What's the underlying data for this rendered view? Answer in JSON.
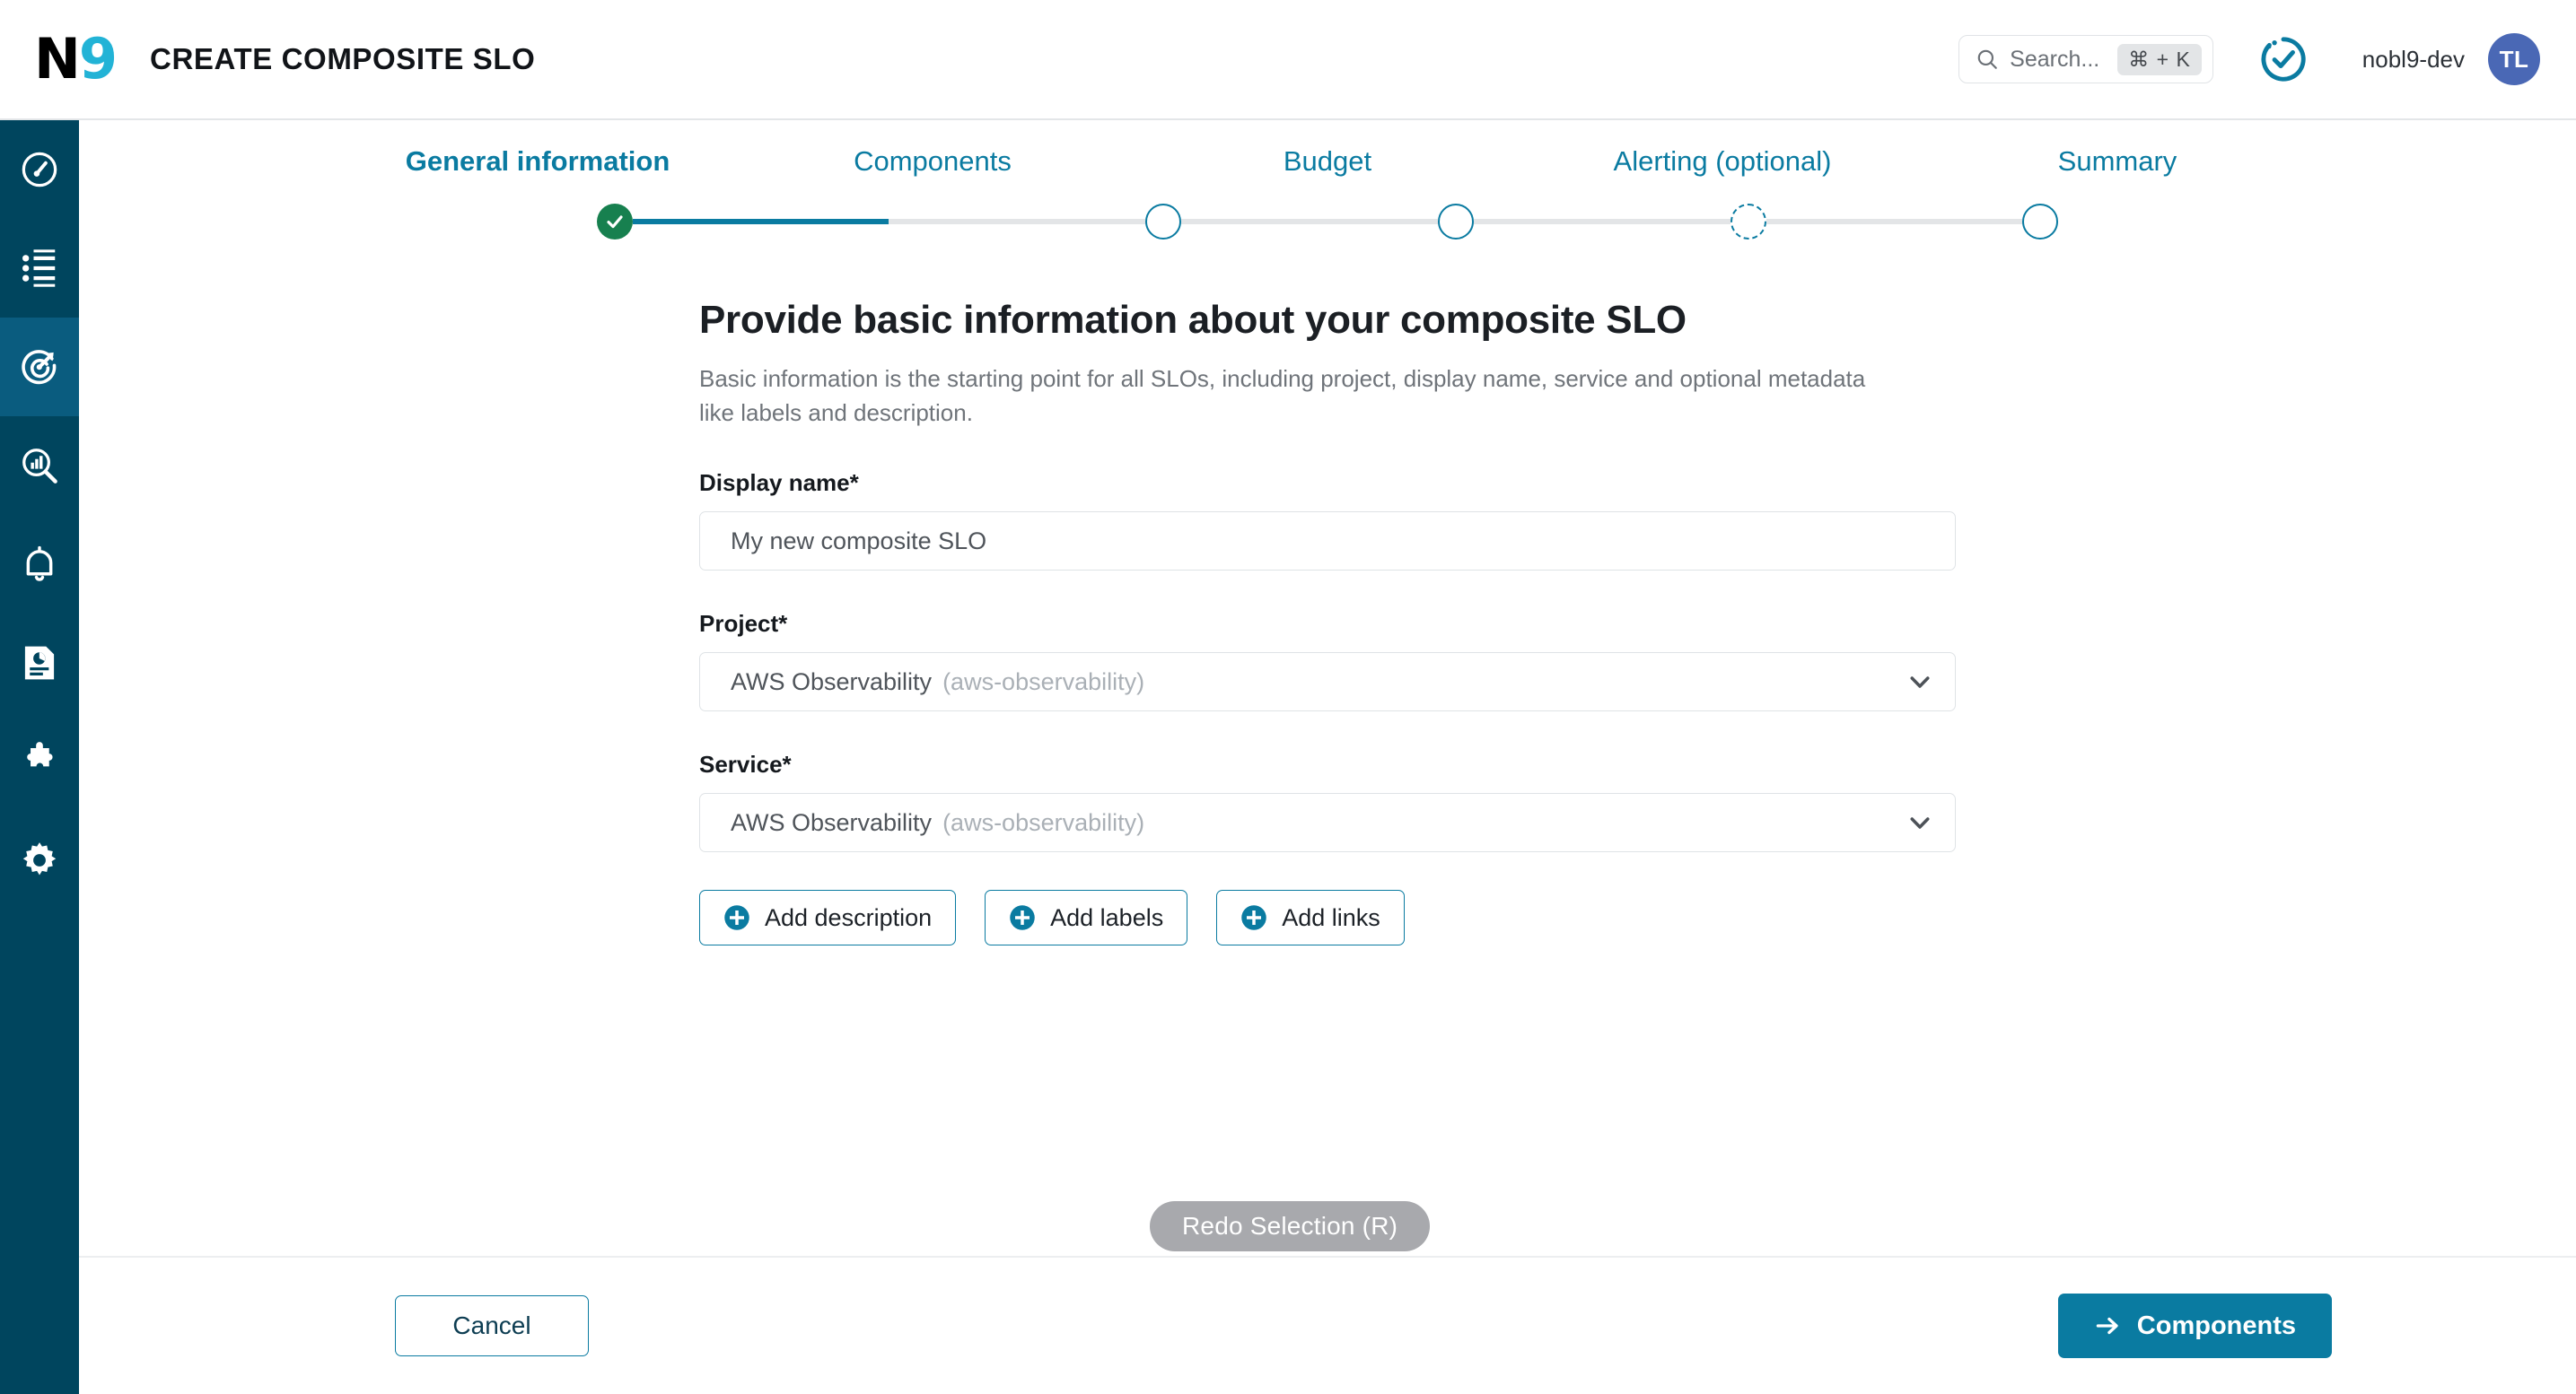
{
  "header": {
    "logo_text_primary": "N",
    "logo_text_accent": "9",
    "title": "CREATE COMPOSITE SLO",
    "search_placeholder": "Search...",
    "search_shortcut": "⌘ + K",
    "org_name": "nobl9-dev",
    "avatar_initials": "TL",
    "status_icon": "check-circle-progress-icon"
  },
  "sidebar": {
    "items": [
      {
        "name": "dashboard",
        "icon": "gauge-icon",
        "active": false
      },
      {
        "name": "service-health",
        "icon": "list-icon",
        "active": false
      },
      {
        "name": "slo-targets",
        "icon": "target-arrow-icon",
        "active": true
      },
      {
        "name": "explorer",
        "icon": "chart-magnifier-icon",
        "active": false
      },
      {
        "name": "alerts",
        "icon": "bell-icon",
        "active": false
      },
      {
        "name": "reports",
        "icon": "report-document-icon",
        "active": false
      },
      {
        "name": "integrations",
        "icon": "puzzle-piece-icon",
        "active": false
      },
      {
        "name": "settings",
        "icon": "gear-icon",
        "active": false
      }
    ]
  },
  "stepper": {
    "steps": [
      {
        "label": "General information",
        "state": "done",
        "current": true
      },
      {
        "label": "Components",
        "state": "todo",
        "current": false
      },
      {
        "label": "Budget",
        "state": "todo",
        "current": false
      },
      {
        "label": "Alerting (optional)",
        "state": "optional",
        "current": false
      },
      {
        "label": "Summary",
        "state": "todo",
        "current": false
      }
    ]
  },
  "panel": {
    "title": "Provide basic information about your composite SLO",
    "description": "Basic information is the starting point for all SLOs, including project, display name, service and optional metadata like labels and description.",
    "fields": {
      "display_name": {
        "label": "Display name*",
        "placeholder": "My new composite SLO",
        "value": "My new composite SLO"
      },
      "project": {
        "label": "Project*",
        "value": "AWS Observability",
        "value_id": "(aws-observability)"
      },
      "service": {
        "label": "Service*",
        "value": "AWS Observability",
        "value_id": "(aws-observability)"
      }
    },
    "buttons": {
      "add_description": "Add description",
      "add_labels": "Add labels",
      "add_links": "Add links"
    }
  },
  "overlay": {
    "redo_pill": "Redo Selection (R)"
  },
  "footer": {
    "cancel": "Cancel",
    "next": "Components"
  },
  "colors": {
    "brand_teal": "#0a7ba1",
    "sidebar": "#00455e",
    "sidebar_active": "#0a5c7f",
    "logo_accent": "#22b3d6",
    "success_green": "#17804f",
    "avatar": "#4a68b5",
    "pill_gray": "#a8a9ad"
  }
}
